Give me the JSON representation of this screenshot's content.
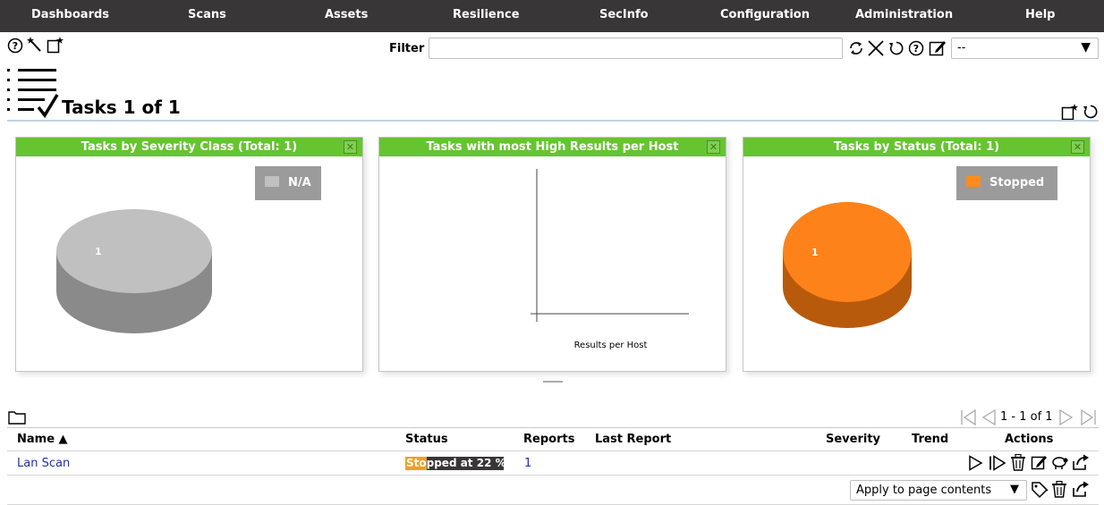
{
  "nav": {
    "items": [
      "Dashboards",
      "Scans",
      "Assets",
      "Resilience",
      "SecInfo",
      "Configuration",
      "Administration",
      "Help"
    ]
  },
  "toolbar": {
    "filter_label": "Filter",
    "filter_value": "",
    "filter_select_value": "--"
  },
  "page": {
    "title": "Tasks 1 of 1"
  },
  "panels": [
    {
      "title": "Tasks by Severity Class (Total: 1)",
      "legend": "N/A",
      "legend_color": "#c0c0c0",
      "slice_label": "1"
    },
    {
      "title": "Tasks with most High Results per Host",
      "xlabel": "Results per Host"
    },
    {
      "title": "Tasks by Status (Total: 1)",
      "legend": "Stopped",
      "legend_color": "#fd8c1c",
      "slice_label": "1"
    }
  ],
  "chart_data": [
    {
      "type": "pie",
      "title": "Tasks by Severity Class (Total: 1)",
      "categories": [
        "N/A"
      ],
      "values": [
        1
      ]
    },
    {
      "type": "bar",
      "title": "Tasks with most High Results per Host",
      "xlabel": "Results per Host",
      "categories": [],
      "values": []
    },
    {
      "type": "pie",
      "title": "Tasks by Status (Total: 1)",
      "categories": [
        "Stopped"
      ],
      "values": [
        1
      ]
    }
  ],
  "pagination": {
    "label": "1 - 1 of 1"
  },
  "table": {
    "headers": {
      "name": "Name ▲",
      "status": "Status",
      "reports": "Reports",
      "last_report": "Last Report",
      "severity": "Severity",
      "trend": "Trend",
      "actions": "Actions"
    },
    "rows": [
      {
        "name": "Lan Scan",
        "status": "Stopped at 22 %",
        "progress": 0.22,
        "reports": "1",
        "last_report": "",
        "severity": "",
        "trend": ""
      }
    ]
  },
  "bulk": {
    "apply_label": "Apply to page contents"
  },
  "colors": {
    "accent": "#66c430",
    "nav_bg": "#393637",
    "link": "#1d2fb5",
    "progress": "#f0a020"
  }
}
